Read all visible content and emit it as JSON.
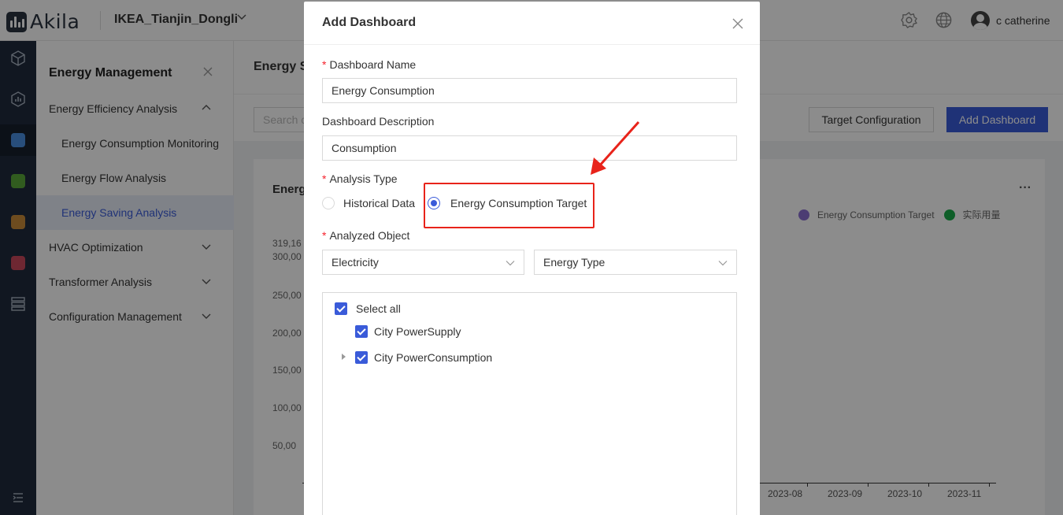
{
  "header": {
    "logo_text": "Akila",
    "project": "IKEA_Tianjin_Dongli",
    "user_name": "c catherine"
  },
  "sidebar": {
    "title": "Energy Management",
    "items": [
      {
        "label": "Energy Efficiency Analysis",
        "level": "top",
        "expanded": true
      },
      {
        "label": "Energy Consumption Monitoring",
        "level": "sub"
      },
      {
        "label": "Energy Flow Analysis",
        "level": "sub"
      },
      {
        "label": "Energy Saving Analysis",
        "level": "sub",
        "selected": true
      },
      {
        "label": "HVAC Optimization",
        "level": "top"
      },
      {
        "label": "Transformer Analysis",
        "level": "top"
      },
      {
        "label": "Configuration Management",
        "level": "top"
      }
    ]
  },
  "main": {
    "title": "Energy S",
    "search_placeholder": "Search c",
    "target_config_label": "Target Configuration",
    "add_dashboard_label": "Add Dashboard",
    "card_title": "Energ",
    "legend": [
      {
        "label": "Energy Consumption Target",
        "color": "#8a6fd1"
      },
      {
        "label": "实际用量",
        "color": "#1aab4a"
      }
    ],
    "y_ticks": [
      "319,16",
      "300,00",
      "250,00",
      "200,00",
      "150,00",
      "100,00",
      "50,00"
    ],
    "x_ticks": [
      "2023-08",
      "2023-09",
      "2023-10",
      "2023-11"
    ]
  },
  "modal": {
    "title": "Add Dashboard",
    "name_label": "Dashboard Name",
    "name_value": "Energy Consumption",
    "desc_label": "Dashboard Description",
    "desc_value": "Consumption",
    "analysis_label": "Analysis Type",
    "analysis_options": [
      {
        "label": "Historical Data",
        "checked": false
      },
      {
        "label": "Energy Consumption Target",
        "checked": true
      }
    ],
    "object_label": "Analyzed Object",
    "object_select": "Electricity",
    "energy_type_select": "Energy Type",
    "tree": {
      "select_all": "Select all",
      "items": [
        "City PowerSupply",
        "City PowerConsumption"
      ]
    }
  },
  "colors": {
    "primary": "#3a5bd9",
    "annotation": "#e8231a"
  }
}
